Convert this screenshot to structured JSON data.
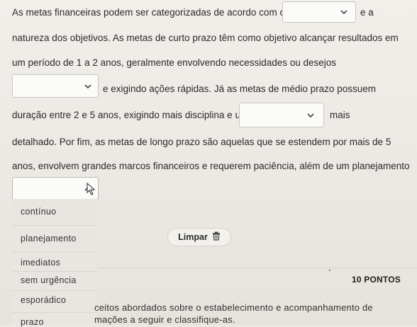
{
  "question": {
    "line1": "As metas financeiras podem ser categorizadas de acordo com o",
    "line1_tail": "e a",
    "line2": "natureza dos objetivos. As metas de curto prazo têm como objetivo alcançar resultados em",
    "line3": "um período de 1 a 2 anos, geralmente envolvendo necessidades ou desejos",
    "line4_tail": "e exigindo ações rápidas. Já as metas de médio prazo possuem",
    "line5_head": "duração entre 2 e 5 anos, exigindo mais disciplina e um",
    "line5_tail": "mais",
    "line6": "detalhado. Por fim, as metas de longo prazo são aquelas que se estendem por mais de 5",
    "line7": "anos, envolvem grandes marcos financeiros e requerem paciência, além de um planejamento"
  },
  "selects": {
    "select1": {
      "value": ""
    },
    "select2": {
      "value": ""
    },
    "select3": {
      "value": ""
    },
    "select4": {
      "value": ""
    }
  },
  "dropdown": {
    "options": [
      "contínuo",
      "planejamento",
      "imediatos",
      "sem urgência",
      "esporádico",
      "prazo"
    ]
  },
  "actions": {
    "clear_label": "Limpar"
  },
  "next_question": {
    "points": "10 PONTOS",
    "line1": "ceitos abordados sobre o estabelecimento e acompanhamento de",
    "line2": "mações a seguir e classifique-as."
  },
  "icons": {
    "chevron": "chevron-down-icon",
    "chevron_up": "chevron-up-icon",
    "trash": "trash-icon",
    "cursor": "mouse-pointer-icon"
  }
}
